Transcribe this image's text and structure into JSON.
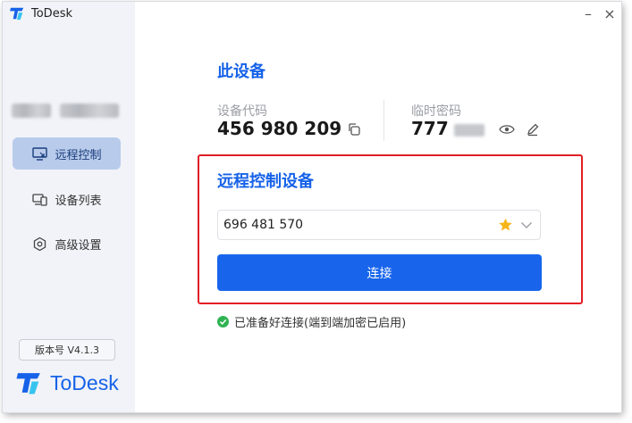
{
  "app": {
    "title": "ToDesk",
    "brand": "ToDesk",
    "accent_color": "#1662e8",
    "version_label": "版本号 V4.1.3"
  },
  "window_controls": {
    "minimize": "–",
    "close": "×"
  },
  "sidebar": {
    "items": [
      {
        "label": "远程控制",
        "icon": "monitor-remote-icon",
        "active": true
      },
      {
        "label": "设备列表",
        "icon": "devices-icon",
        "active": false
      },
      {
        "label": "高级设置",
        "icon": "settings-icon",
        "active": false
      }
    ]
  },
  "this_device": {
    "heading": "此设备",
    "device_code_label": "设备代码",
    "device_code": "456 980 209",
    "temp_password_label": "临时密码",
    "temp_password_visible": "777"
  },
  "remote_control": {
    "heading": "远程控制设备",
    "input_value": "696 481 570",
    "connect_label": "连接",
    "highlight_color": "#e21d25"
  },
  "status": {
    "text": "已准备好连接(端到端加密已启用)",
    "color": "#2fb352"
  }
}
